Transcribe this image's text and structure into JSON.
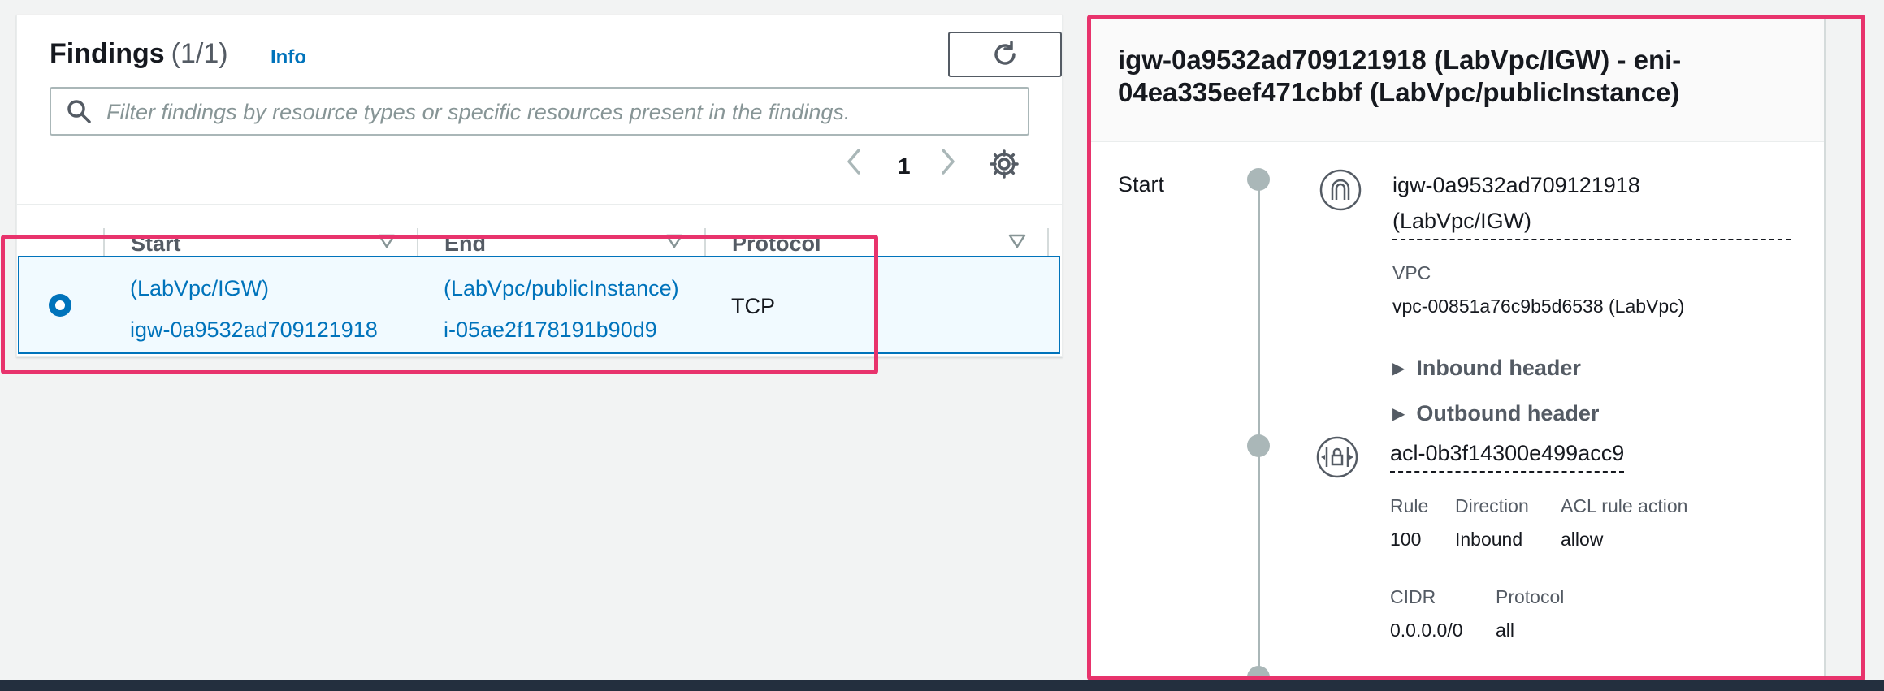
{
  "findings": {
    "title": "Findings",
    "count": "(1/1)",
    "info_label": "Info",
    "refresh_icon": "refresh-icon",
    "search": {
      "placeholder": "Filter findings by resource types or specific resources present in the findings.",
      "value": "",
      "icon": "search-icon"
    },
    "pagination": {
      "current_page": "1"
    },
    "columns": [
      {
        "label": "Start"
      },
      {
        "label": "End"
      },
      {
        "label": "Protocol"
      }
    ],
    "rows": [
      {
        "selected": true,
        "start_name": "(LabVpc/IGW)",
        "start_id": "igw-0a9532ad709121918",
        "end_name": "(LabVpc/publicInstance)",
        "end_id": "i-05ae2f178191b90d9",
        "protocol": "TCP"
      }
    ]
  },
  "detail": {
    "title": "igw-0a9532ad709121918 (LabVpc/IGW) - eni-04ea335eef471cbbf (LabVpc/publicInstance)",
    "start_label": "Start",
    "nodes": [
      {
        "icon": "internet-gateway-icon",
        "name_line1": "igw-0a9532ad709121918",
        "name_line2": "(LabVpc/IGW)",
        "vpc_label": "VPC",
        "vpc_value": "vpc-00851a76c9b5d6538 (LabVpc)",
        "inbound_header": "Inbound header",
        "outbound_header": "Outbound header"
      },
      {
        "icon": "network-acl-icon",
        "name": "acl-0b3f14300e499acc9",
        "rule_label": "Rule",
        "rule_value": "100",
        "direction_label": "Direction",
        "direction_value": "Inbound",
        "action_label": "ACL rule action",
        "action_value": "allow",
        "cidr_label": "CIDR",
        "cidr_value": "0.0.0.0/0",
        "protocol_label": "Protocol",
        "protocol_value": "all"
      }
    ]
  },
  "colors": {
    "accent": "#0073bb",
    "highlight": "#e8336c",
    "selected_row_bg": "#f1faff"
  }
}
